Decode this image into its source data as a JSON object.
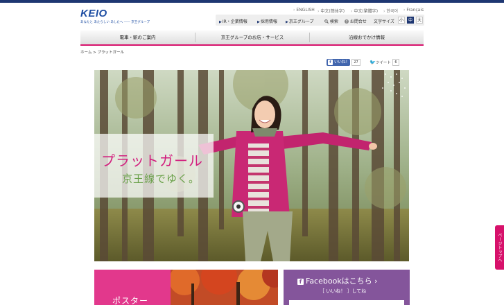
{
  "logo": {
    "word": "KEIO",
    "tagline": "あなたと あたらしい あしたへ ―― 京王グループ"
  },
  "languages": [
    "ENGLISH",
    "中文(簡体字)",
    "中文(繁體字)",
    "한국어",
    "Français"
  ],
  "utility": {
    "ir": "IR・企業情報",
    "recruit": "採用情報",
    "group": "京王グループ",
    "search": "検索",
    "contact": "お問合せ",
    "font_size_label": "文字サイズ",
    "font_sizes": [
      "小",
      "中",
      "大"
    ]
  },
  "global_nav": [
    "電車・駅のご案内",
    "京王グループのお店・サービス",
    "沿線おでかけ情報"
  ],
  "breadcrumb": {
    "home": "ホーム",
    "separator": " > ",
    "current": "プラットガール"
  },
  "social": {
    "like_label": "いいね！",
    "like_count": "27",
    "tweet_label": "ツイート",
    "tweet_count": "6"
  },
  "hero": {
    "title": "プラットガール",
    "subtitle": "京王線でゆく。"
  },
  "page_top": "ページトップへ",
  "poster": {
    "label": "ポスター"
  },
  "facebook": {
    "title": "Facebookはこちら",
    "sub": "［ いいね！ ］してね"
  },
  "colors": {
    "accent": "#d7116b",
    "brand": "#1d4da2",
    "facebook_purple": "#84559b"
  }
}
